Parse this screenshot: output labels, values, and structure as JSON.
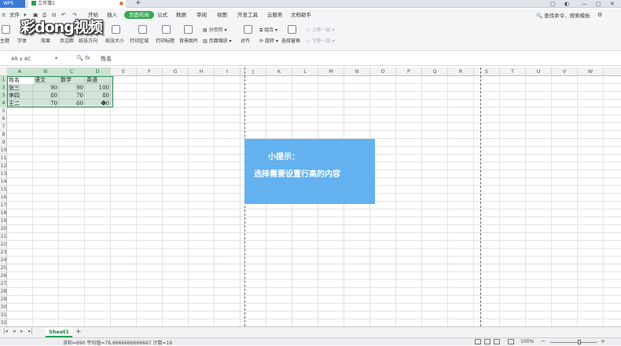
{
  "titlebar": {
    "wps_tab": "WPS",
    "workbook_tab": "工作簿1",
    "add_tab": "+"
  },
  "menubar": {
    "file": "文件",
    "items": [
      "开始",
      "插入",
      "页面布局",
      "公式",
      "数据",
      "审阅",
      "视图",
      "开发工具",
      "云服务",
      "文档助手"
    ],
    "search": "查找命令、搜索模板"
  },
  "ribbon": {
    "theme": "主题",
    "font": "字体",
    "effect": "效果",
    "margin": "页边距",
    "orientation": "纸张方向",
    "paper_size": "纸张大小",
    "print_area": "打印区域",
    "print_title": "打印标题",
    "background": "背景图片",
    "page_break": "分页符",
    "page_zoom": "页面缩放",
    "align": "对齐",
    "group": "组合",
    "rotate": "旋转",
    "selection_pane": "选择窗格",
    "move_up": "上移一层",
    "move_down": "下移一层"
  },
  "logo": "彩dong视频",
  "formula_bar": {
    "name_box": "4R x 4C",
    "value": "姓名"
  },
  "columns": [
    "A",
    "B",
    "C",
    "D",
    "E",
    "F",
    "G",
    "H",
    "I",
    "J",
    "K",
    "L",
    "M",
    "N",
    "O",
    "P",
    "Q",
    "R",
    "S",
    "T",
    "U",
    "V",
    "W"
  ],
  "rows": [
    "1",
    "2",
    "3",
    "4",
    "5",
    "6",
    "7",
    "8",
    "9",
    "10",
    "11",
    "12",
    "13",
    "14",
    "15",
    "16",
    "17",
    "18",
    "19",
    "20",
    "21",
    "22",
    "23",
    "24",
    "25",
    "26",
    "27",
    "28",
    "29",
    "30",
    "31",
    "32"
  ],
  "table": {
    "headers": [
      "姓名",
      "语文",
      "数学",
      "英语"
    ],
    "rows": [
      [
        "张三",
        "90",
        "90",
        "100"
      ],
      [
        "李四",
        "80",
        "70",
        "80"
      ],
      [
        "王二",
        "70",
        "60",
        "90"
      ]
    ]
  },
  "tip": {
    "title": "小提示：",
    "body": "选择需要设置行高的内容"
  },
  "sheet_tab": "Sheet1",
  "status": {
    "text": "求和=690  平均值=76.6666666666667  计数=16",
    "zoom": "100%"
  }
}
